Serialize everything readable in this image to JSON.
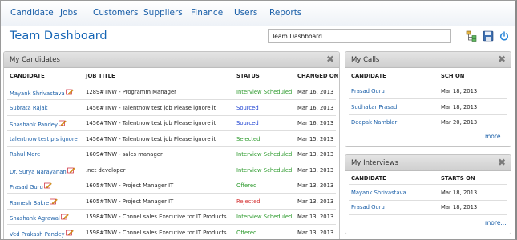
{
  "nav": [
    "Candidate",
    "Jobs",
    "Customers",
    "Suppliers",
    "Finance",
    "Users",
    "Reports"
  ],
  "page_title": "Team Dashboard",
  "search_value": "Team Dashboard.",
  "toolbar_icons": [
    "sitemap-icon",
    "save-icon",
    "power-icon"
  ],
  "candidates_panel": {
    "title": "My Candidates",
    "headers": [
      "CANDIDATE",
      "JOB TITLE",
      "STATUS",
      "CHANGED ON"
    ],
    "rows": [
      {
        "candidate": "Mayank Shrivastava",
        "edit_icon": true,
        "job": "1289#TNW - Programm Manager",
        "status": "Interview Scheduled",
        "status_color": "green",
        "changed": "Mar 16, 2013"
      },
      {
        "candidate": "Subrata Rajak",
        "edit_icon": false,
        "job": "1456#TNW - Talentnow test job Please ignore it",
        "status": "Sourced",
        "status_color": "blue",
        "changed": "Mar 16, 2013"
      },
      {
        "candidate": "Shashank Pandey",
        "edit_icon": true,
        "job": "1456#TNW - Talentnow test job Please ignore it",
        "status": "Sourced",
        "status_color": "blue",
        "changed": "Mar 16, 2013"
      },
      {
        "candidate": "talentnow test pls ignore",
        "edit_icon": false,
        "job": "1456#TNW - Talentnow test job Please ignore it",
        "status": "Selected",
        "status_color": "green",
        "changed": "Mar 15, 2013"
      },
      {
        "candidate": "Rahul More",
        "edit_icon": false,
        "job": "1609#TNW - sales manager",
        "status": "Interview Scheduled",
        "status_color": "green",
        "changed": "Mar 13, 2013"
      },
      {
        "candidate": "Dr. Surya Narayanan",
        "edit_icon": true,
        "job": ".net developer",
        "status": "Interview Scheduled",
        "status_color": "green",
        "changed": "Mar 13, 2013"
      },
      {
        "candidate": "Prasad Guru",
        "edit_icon": true,
        "job": "1605#TNW - Project Manager IT",
        "status": "Offered",
        "status_color": "green",
        "changed": "Mar 13, 2013"
      },
      {
        "candidate": "Ramesh Bakre",
        "edit_icon": true,
        "job": "1605#TNW - Project Manager IT",
        "status": "Rejected",
        "status_color": "red",
        "changed": "Mar 13, 2013"
      },
      {
        "candidate": "Shashank Agrawal",
        "edit_icon": true,
        "job": "1598#TNW - Chnnel sales Executive for IT Products",
        "status": "Interview Scheduled",
        "status_color": "green",
        "changed": "Mar 13, 2013"
      },
      {
        "candidate": "Ved Prakash Pandey",
        "edit_icon": true,
        "job": "1598#TNW - Chnnel sales Executive for IT Products",
        "status": "Offered",
        "status_color": "green",
        "changed": "Mar 13, 2013"
      }
    ]
  },
  "calls_panel": {
    "title": "My Calls",
    "headers": [
      "CANDIDATE",
      "SCH ON"
    ],
    "rows": [
      {
        "candidate": "Prasad Guru",
        "date": "Mar 18, 2013"
      },
      {
        "candidate": "Sudhakar Prasad",
        "date": "Mar 18, 2013"
      },
      {
        "candidate": "Deepak Namblar",
        "date": "Mar 20, 2013"
      }
    ],
    "more": "more..."
  },
  "interviews_panel": {
    "title": "My Interviews",
    "headers": [
      "CANDIDATE",
      "STARTS ON"
    ],
    "rows": [
      {
        "candidate": "Mayank Shrivastava",
        "date": "Mar 18, 2013"
      },
      {
        "candidate": "Prasad Guru",
        "date": "Mar 18, 2013"
      }
    ],
    "more": "more..."
  },
  "colors": {
    "link": "#1a5fa8",
    "title": "#1565b5",
    "status_green": "#2e9b2e",
    "status_blue": "#1a3fd0",
    "status_red": "#d43030"
  }
}
